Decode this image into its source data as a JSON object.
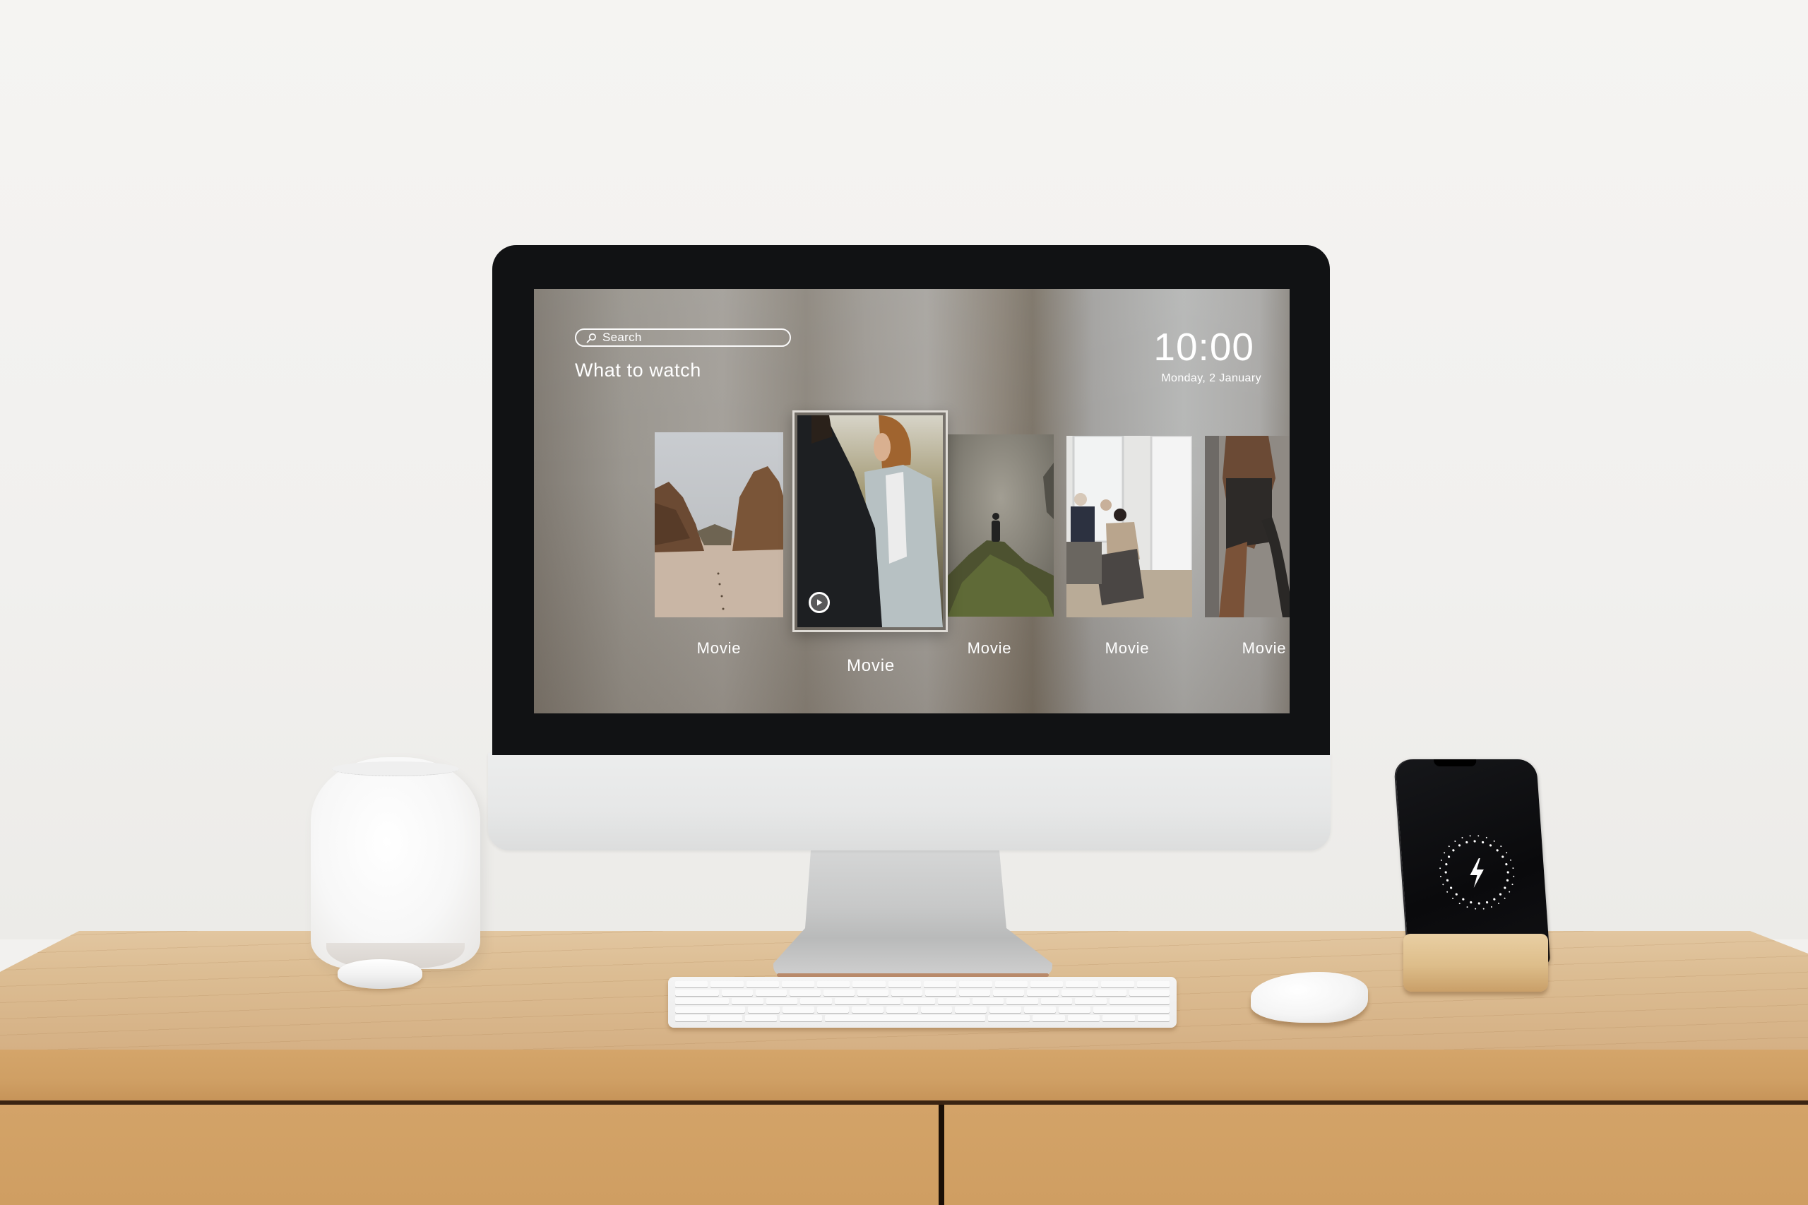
{
  "screen": {
    "search": {
      "placeholder": "Search",
      "icon": "search-icon"
    },
    "heading": "What to watch",
    "clock": {
      "time": "10:00",
      "date": "Monday, 2 January"
    },
    "carousel": {
      "focused_index": 1,
      "items": [
        {
          "label": "Movie",
          "scene": "rock-arch-beach"
        },
        {
          "label": "Movie",
          "scene": "couple-at-sunset",
          "play_icon": "play-icon"
        },
        {
          "label": "Movie",
          "scene": "hiker-on-misty-peak"
        },
        {
          "label": "Movie",
          "scene": "office-meeting"
        },
        {
          "label": "Movie",
          "scene": "battle-ropes-workout"
        }
      ]
    }
  },
  "phone": {
    "screen_icon": "lightning-bolt-icon",
    "state": "charging"
  },
  "colors": {
    "wall": "#f2f1ef",
    "desk": "#d4a56a",
    "bezel": "#111214",
    "ui_text": "#ffffff"
  }
}
